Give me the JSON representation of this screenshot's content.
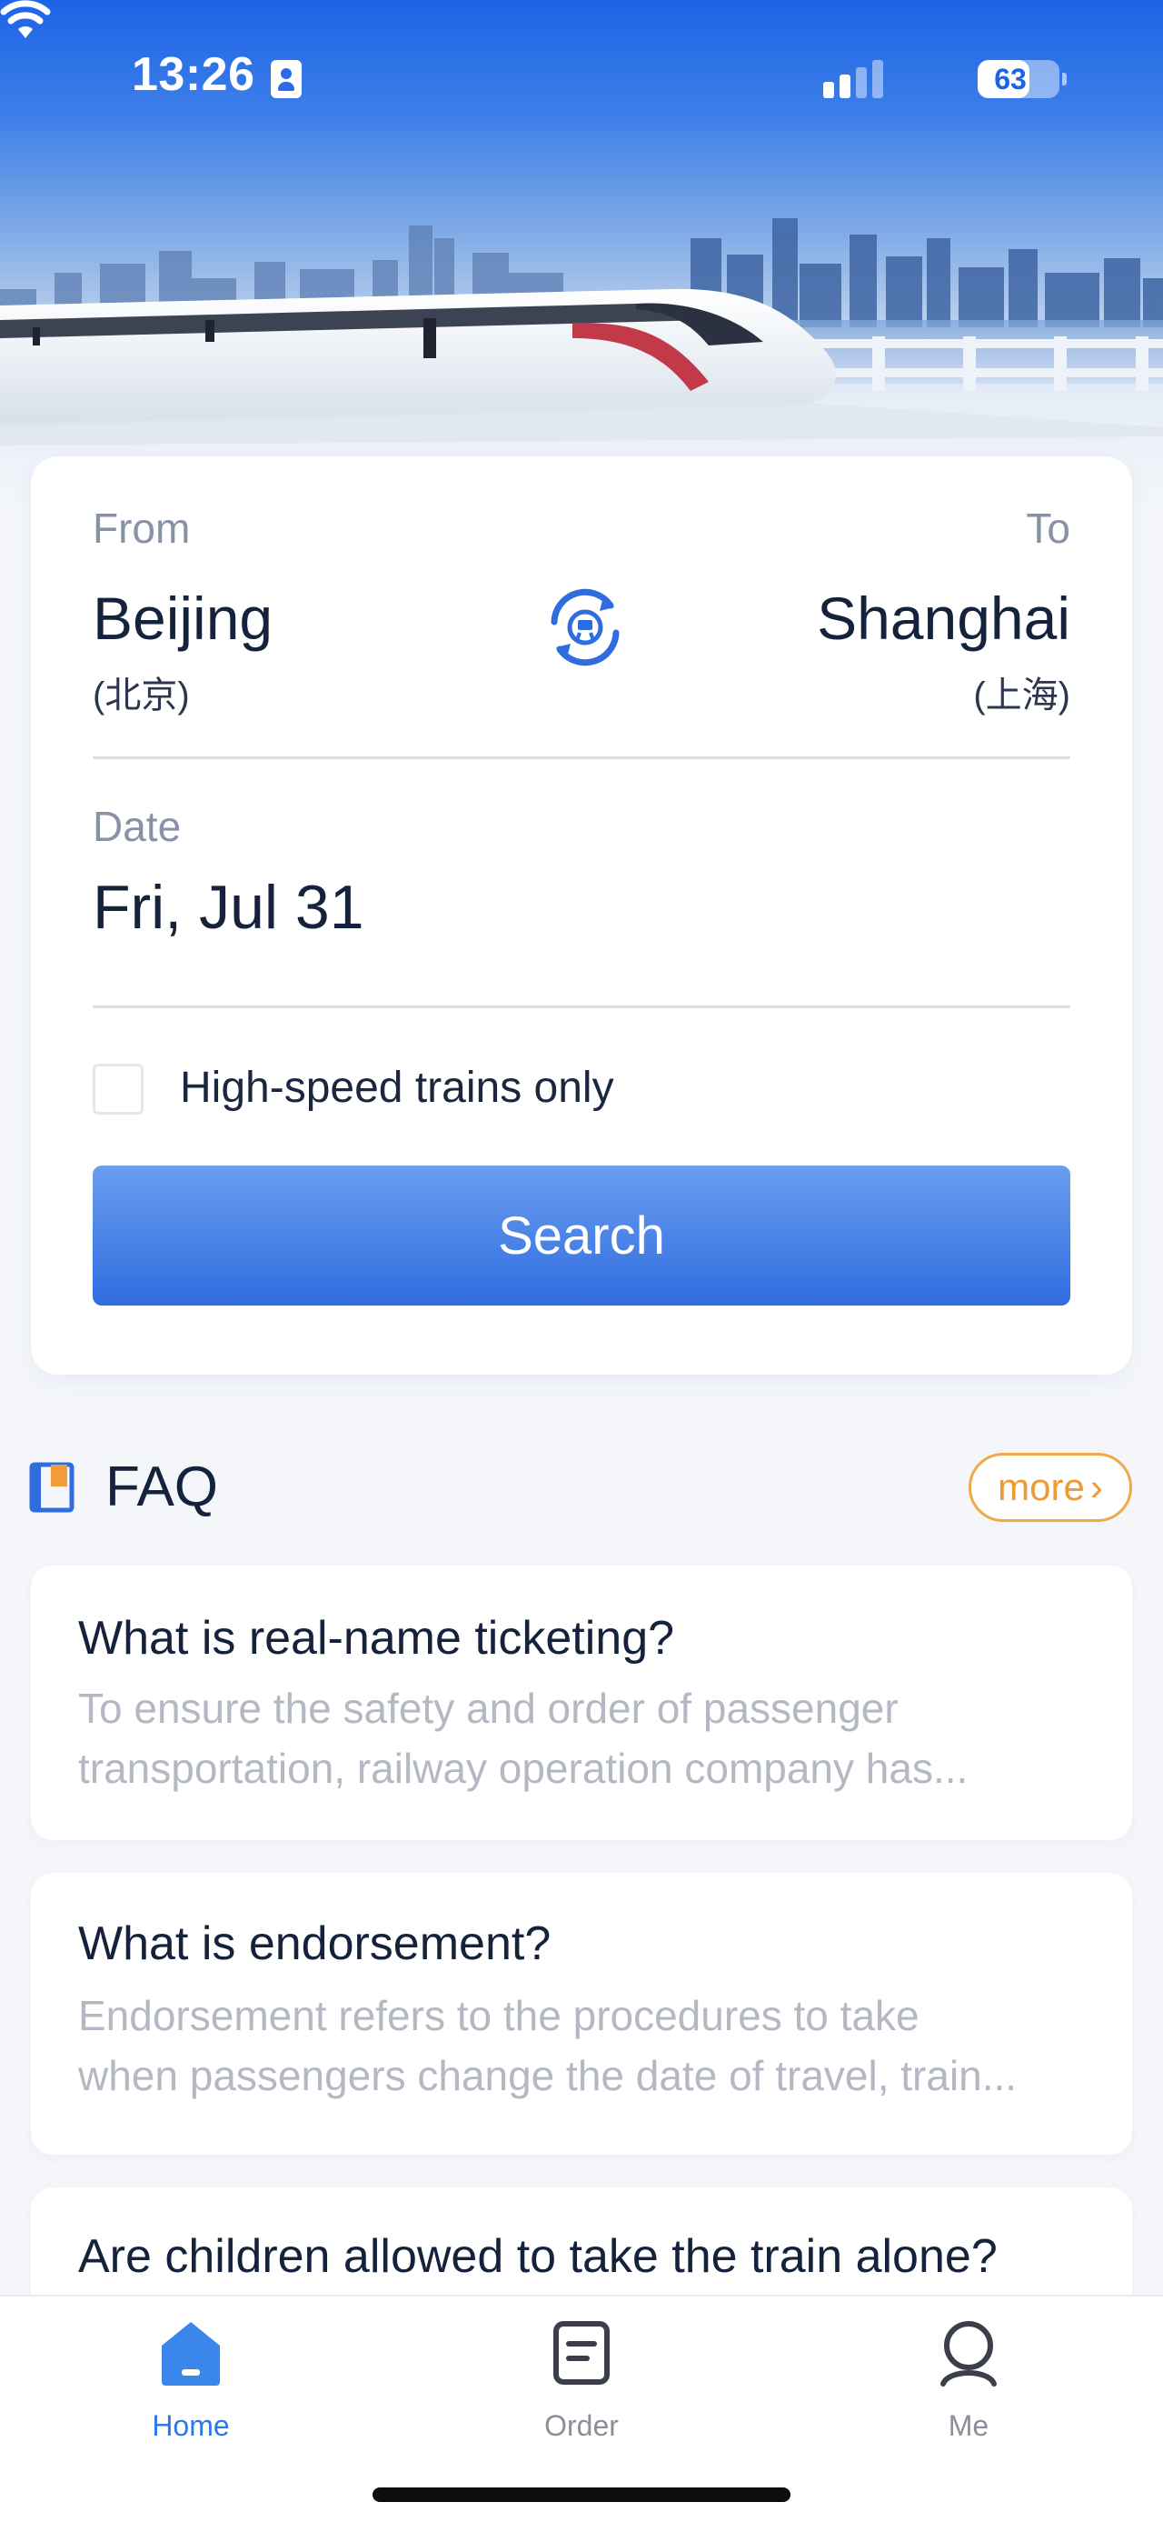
{
  "status_bar": {
    "time": "13:26",
    "battery_level": "63",
    "battery_fraction": 0.63,
    "icons": [
      "person-id-icon",
      "cellular-signal-icon",
      "wifi-icon",
      "battery-icon"
    ]
  },
  "search_form": {
    "from_label": "From",
    "to_label": "To",
    "from_city": "Beijing",
    "from_city_local": "(北京)",
    "to_city": "Shanghai",
    "to_city_local": "(上海)",
    "date_label": "Date",
    "date_value": "Fri, Jul 31",
    "high_speed_label": "High-speed trains only",
    "high_speed_checked": false,
    "search_label": "Search"
  },
  "faq": {
    "title": "FAQ",
    "more_label": "more",
    "items": [
      {
        "question": "What is real-name ticketing?",
        "answer_line1": "To ensure the safety and order of passenger",
        "answer_line2": "transportation, railway operation company has..."
      },
      {
        "question": "What is endorsement?",
        "answer_line1": "Endorsement refers to the procedures to take",
        "answer_line2": "when passengers change the date of travel, train..."
      },
      {
        "question": "Are children allowed to take the train alone?"
      }
    ]
  },
  "tabbar": {
    "active": "Home",
    "tabs": [
      {
        "label": "Home",
        "icon": "home-icon"
      },
      {
        "label": "Order",
        "icon": "order-icon"
      },
      {
        "label": "Me",
        "icon": "profile-icon"
      }
    ]
  },
  "colors": {
    "accent": "#2f6ddf",
    "accent_light": "#6b9ef0",
    "more_orange": "#ee9a35",
    "text_primary": "#15223b",
    "text_muted": "#8792a6",
    "tab_inactive": "#8a8f99",
    "tab_active": "#2f78e6"
  }
}
